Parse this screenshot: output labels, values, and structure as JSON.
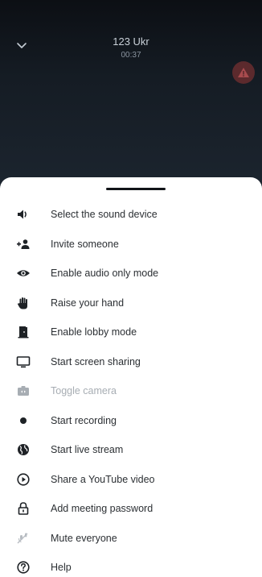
{
  "call": {
    "title": "123 Ukr",
    "timer": "00:37"
  },
  "menu": {
    "items": [
      {
        "label": "Select the sound device",
        "icon": "speaker-icon"
      },
      {
        "label": "Invite someone",
        "icon": "add-person-icon"
      },
      {
        "label": "Enable audio only mode",
        "icon": "eye-icon"
      },
      {
        "label": "Raise your hand",
        "icon": "hand-icon"
      },
      {
        "label": "Enable lobby mode",
        "icon": "door-icon"
      },
      {
        "label": "Start screen sharing",
        "icon": "monitor-icon"
      },
      {
        "label": "Toggle camera",
        "icon": "camera-switch-icon",
        "disabled": true
      },
      {
        "label": "Start recording",
        "icon": "record-icon"
      },
      {
        "label": "Start live stream",
        "icon": "globe-icon"
      },
      {
        "label": "Share a YouTube video",
        "icon": "play-circle-icon"
      },
      {
        "label": "Add meeting password",
        "icon": "lock-icon"
      },
      {
        "label": "Mute everyone",
        "icon": "mute-everyone-icon"
      },
      {
        "label": "Help",
        "icon": "help-icon"
      }
    ]
  },
  "colors": {
    "call_background": "#151c24",
    "text": "#2b2f33",
    "disabled_text": "#a7adb3",
    "warning_badge": "#5c2a2d"
  }
}
